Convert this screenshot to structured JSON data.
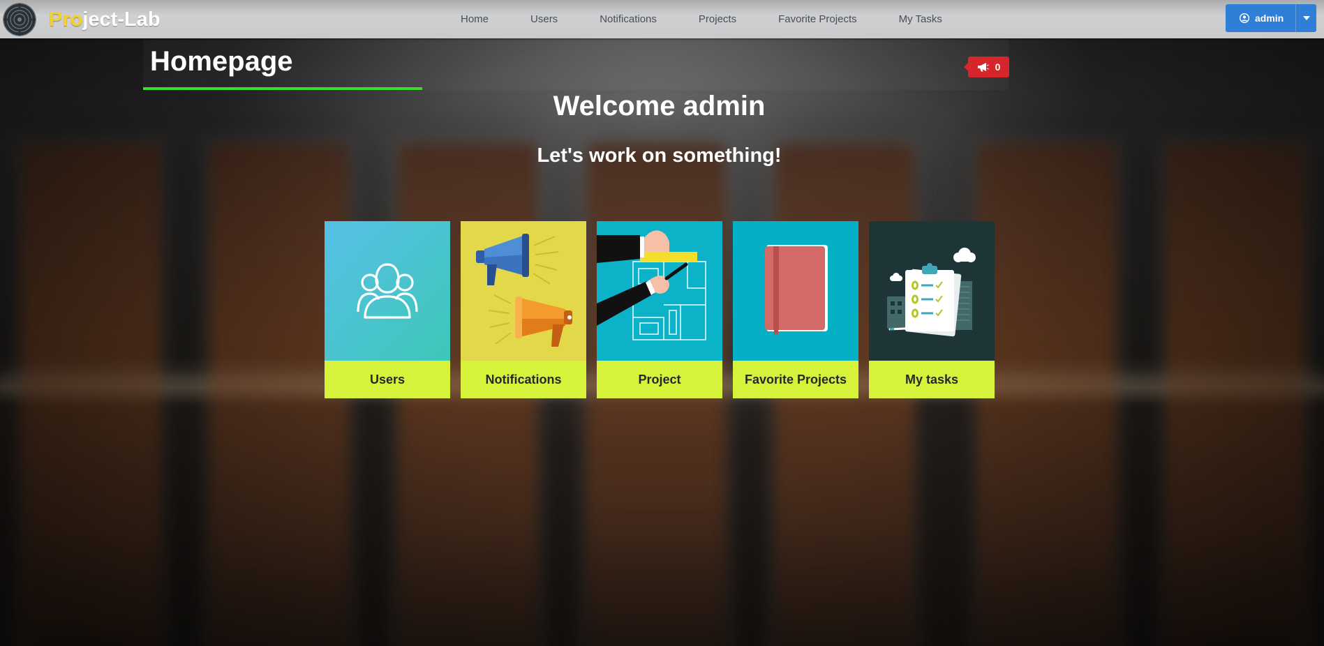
{
  "brand": {
    "prefix": "Pro",
    "rest": "ject-Lab"
  },
  "nav": {
    "links": [
      "Home",
      "Users",
      "Notifications",
      "Projects",
      "Favorite Projects",
      "My Tasks"
    ]
  },
  "user_menu": {
    "label": "admin",
    "icons": [
      "user-circle-icon",
      "caret-down-icon"
    ]
  },
  "header": {
    "title": "Homepage"
  },
  "notifications_badge": {
    "count": "0",
    "icon": "megaphone-icon"
  },
  "main": {
    "welcome": "Welcome admin",
    "subline": "Let's work on something!"
  },
  "cards": [
    {
      "label": "Users",
      "icon": "users-group-icon"
    },
    {
      "label": "Notifications",
      "icon": "megaphone-icon"
    },
    {
      "label": "Project",
      "icon": "blueprint-icon"
    },
    {
      "label": "Favorite Projects",
      "icon": "notebook-icon"
    },
    {
      "label": "My tasks",
      "icon": "checklist-icon"
    }
  ],
  "colors": {
    "navbar": "#c9cacc",
    "brand_accent": "#f4cf2d",
    "user_button": "#2f7fd6",
    "title_underline": "#3bdc2f",
    "badge": "#d6262b",
    "card_label": "#d6f23a",
    "card_users": "#4fc3e0",
    "card_notifications": "#e2d84a",
    "card_project": "#0cb2c8",
    "card_favorite": "#05b0c6",
    "card_tasks": "#1d3537"
  }
}
